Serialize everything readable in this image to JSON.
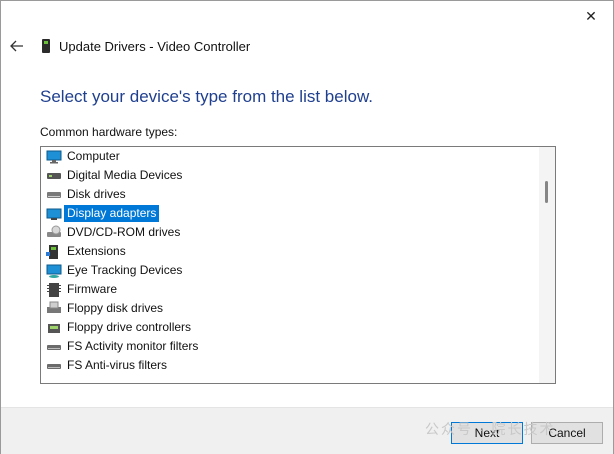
{
  "window": {
    "title": "Update Drivers - Video Controller",
    "close_glyph": "✕"
  },
  "page": {
    "heading": "Select your device's type from the list below.",
    "list_label": "Common hardware types:"
  },
  "hardware_types": [
    {
      "label": "Computer",
      "icon": "computer-icon",
      "selected": false
    },
    {
      "label": "Digital Media Devices",
      "icon": "media-device-icon",
      "selected": false
    },
    {
      "label": "Disk drives",
      "icon": "disk-drive-icon",
      "selected": false
    },
    {
      "label": "Display adapters",
      "icon": "display-adapter-icon",
      "selected": true
    },
    {
      "label": "DVD/CD-ROM drives",
      "icon": "dvd-drive-icon",
      "selected": false
    },
    {
      "label": "Extensions",
      "icon": "extensions-icon",
      "selected": false
    },
    {
      "label": "Eye Tracking Devices",
      "icon": "eye-tracking-icon",
      "selected": false
    },
    {
      "label": "Firmware",
      "icon": "firmware-icon",
      "selected": false
    },
    {
      "label": "Floppy disk drives",
      "icon": "floppy-drive-icon",
      "selected": false
    },
    {
      "label": "Floppy drive controllers",
      "icon": "floppy-controller-icon",
      "selected": false
    },
    {
      "label": "FS Activity monitor filters",
      "icon": "fs-filter-icon",
      "selected": false
    },
    {
      "label": "FS Anti-virus filters",
      "icon": "fs-filter-icon",
      "selected": false
    }
  ],
  "buttons": {
    "next": "Next",
    "cancel": "Cancel"
  },
  "watermark": "公众号 · 院长技术",
  "colors": {
    "heading": "#1f3f8f",
    "selection": "#0078d7"
  }
}
